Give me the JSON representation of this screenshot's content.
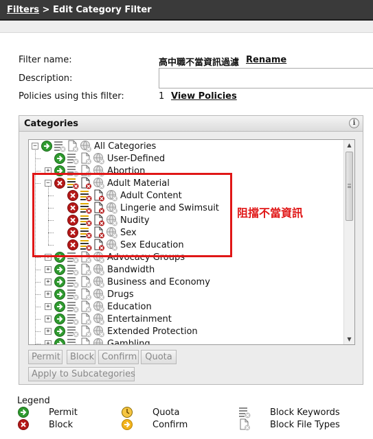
{
  "breadcrumb": {
    "root": "Filters",
    "separator": ">",
    "current": "Edit Category Filter"
  },
  "form": {
    "filter_name_label": "Filter name:",
    "filter_name_value": "高中職不當資訊過濾",
    "rename_link": "Rename",
    "description_label": "Description:",
    "description_value": "",
    "policies_label": "Policies using this filter:",
    "policies_count": "1",
    "view_policies_link": "View Policies"
  },
  "categories_panel": {
    "title": "Categories",
    "info_glyph": "i",
    "tree": [
      {
        "label": "All Categories",
        "status": "permit",
        "expander": "minus",
        "level": 0
      },
      {
        "label": "User-Defined",
        "status": "permit",
        "expander": "none",
        "level": 1
      },
      {
        "label": "Abortion",
        "status": "permit",
        "expander": "plus",
        "level": 1
      },
      {
        "label": "Adult Material",
        "status": "block",
        "expander": "minus",
        "level": 1
      },
      {
        "label": "Adult Content",
        "status": "block",
        "expander": "none",
        "level": 2
      },
      {
        "label": "Lingerie and Swimsuit",
        "status": "block",
        "expander": "none",
        "level": 2
      },
      {
        "label": "Nudity",
        "status": "block",
        "expander": "none",
        "level": 2
      },
      {
        "label": "Sex",
        "status": "block",
        "expander": "none",
        "level": 2
      },
      {
        "label": "Sex Education",
        "status": "block",
        "expander": "none",
        "level": 2
      },
      {
        "label": "Advocacy Groups",
        "status": "permit",
        "expander": "plus",
        "level": 1
      },
      {
        "label": "Bandwidth",
        "status": "permit",
        "expander": "plus",
        "level": 1
      },
      {
        "label": "Business and Economy",
        "status": "permit",
        "expander": "plus",
        "level": 1
      },
      {
        "label": "Drugs",
        "status": "permit",
        "expander": "plus",
        "level": 1
      },
      {
        "label": "Education",
        "status": "permit",
        "expander": "plus",
        "level": 1
      },
      {
        "label": "Entertainment",
        "status": "permit",
        "expander": "plus",
        "level": 1
      },
      {
        "label": "Extended Protection",
        "status": "permit",
        "expander": "plus",
        "level": 1
      },
      {
        "label": "Gambling",
        "status": "permit",
        "expander": "plus",
        "level": 1
      }
    ],
    "buttons": {
      "permit": "Permit",
      "block": "Block",
      "confirm": "Confirm",
      "quota": "Quota",
      "apply": "Apply to Subcategories"
    }
  },
  "annotation": {
    "text": "阻擋不當資訊",
    "color": "#e01616"
  },
  "legend": {
    "title": "Legend",
    "items": {
      "permit": "Permit",
      "block": "Block",
      "quota": "Quota",
      "confirm": "Confirm",
      "block_keywords": "Block Keywords",
      "block_file_types": "Block File Types"
    }
  },
  "colors": {
    "permit": "#2f9a2f",
    "block": "#b51818",
    "confirm": "#f2b31d",
    "quota": "#f5c542",
    "titlebar": "#3a3a3a"
  },
  "icons": {
    "permit": "permit-arrow-icon",
    "block": "block-x-icon",
    "keywords": "block-keywords-icon",
    "filetypes": "block-file-types-icon",
    "bandwidth": "bandwidth-globe-icon",
    "quota": "quota-clock-icon",
    "confirm": "confirm-arrow-icon"
  }
}
